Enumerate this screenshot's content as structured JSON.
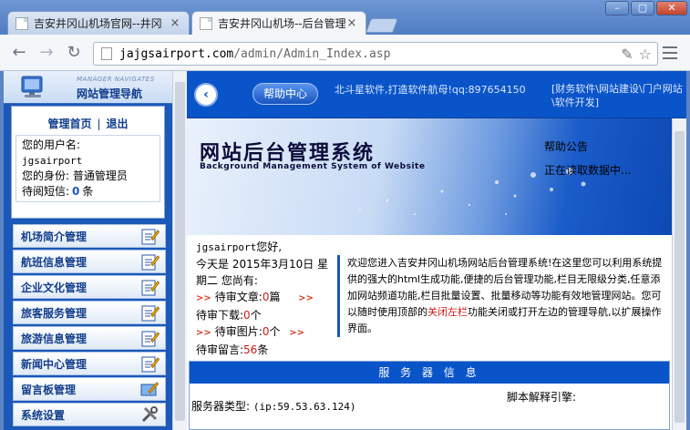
{
  "browser": {
    "tabs": [
      {
        "title": "吉安井冈山机场官网--井冈"
      },
      {
        "title": "吉安井冈山机场--后台管理"
      }
    ],
    "url_host": "jajgsairport.com",
    "url_path": "/admin/Admin_Index.asp"
  },
  "sidebar": {
    "subtitle": "MANAGER NAVIGATES",
    "title": "网站管理导航",
    "home_link": "管理首页",
    "separator": "|",
    "logout_link": "退出",
    "username_label": "您的用户名:",
    "username": "jgsairport",
    "role_label": "您的身份:",
    "role": "普通管理员",
    "messages_label": "待阅短信:",
    "messages_count": "0",
    "messages_unit": "条",
    "menu": [
      {
        "label": "机场简介管理"
      },
      {
        "label": "航班信息管理"
      },
      {
        "label": "企业文化管理"
      },
      {
        "label": "旅客服务管理"
      },
      {
        "label": "旅游信息管理"
      },
      {
        "label": "新闻中心管理"
      },
      {
        "label": "留言板管理"
      },
      {
        "label": "系统设置"
      }
    ]
  },
  "topbar": {
    "help_button": "帮助中心",
    "note": "北斗星软件,打造软件航母!qq:897654150",
    "links": "[财务软件\\网站建设\\门户网站\\软件开发]"
  },
  "banner": {
    "title": "网站后台管理系统",
    "subtitle": "Background Management System of Website",
    "notice_title": "帮助公告",
    "notice_body": "正在读取数据中..."
  },
  "stats": {
    "greeting_user": "jgsairport",
    "greeting_suffix": "您好,",
    "date_line": "今天是 2015年3月10日 星期二 您尚有:",
    "articles_label": "待审文章:",
    "articles_count": "0",
    "articles_unit": "篇",
    "downloads_label": "待审下载:",
    "downloads_count": "0",
    "downloads_unit": "个",
    "images_label": "待审图片:",
    "images_count": "0",
    "images_unit": "个",
    "comments_label": "待审留言:",
    "comments_count": "56",
    "comments_unit": "条",
    "arrow": ">>"
  },
  "welcome": {
    "text_before": "欢迎您进入吉安井冈山机场网站后台管理系统!在这里您可以利用系统提供的强大的html生成功能,便捷的后台管理功能,栏目无限级分类,任意添加网站频道功能,栏目批量设置、批量移动等功能有效地管理网站。您可以随时使用顶部的",
    "link_text": "关闭左栏",
    "text_after": "功能关闭或打开左边的管理导航,以扩展操作界面。"
  },
  "server": {
    "header": "服 务 器 信 息",
    "type_label": "服务器类型:",
    "type_value": "(ip:59.53.63.124)",
    "script_label": "脚本解释引擎:"
  }
}
